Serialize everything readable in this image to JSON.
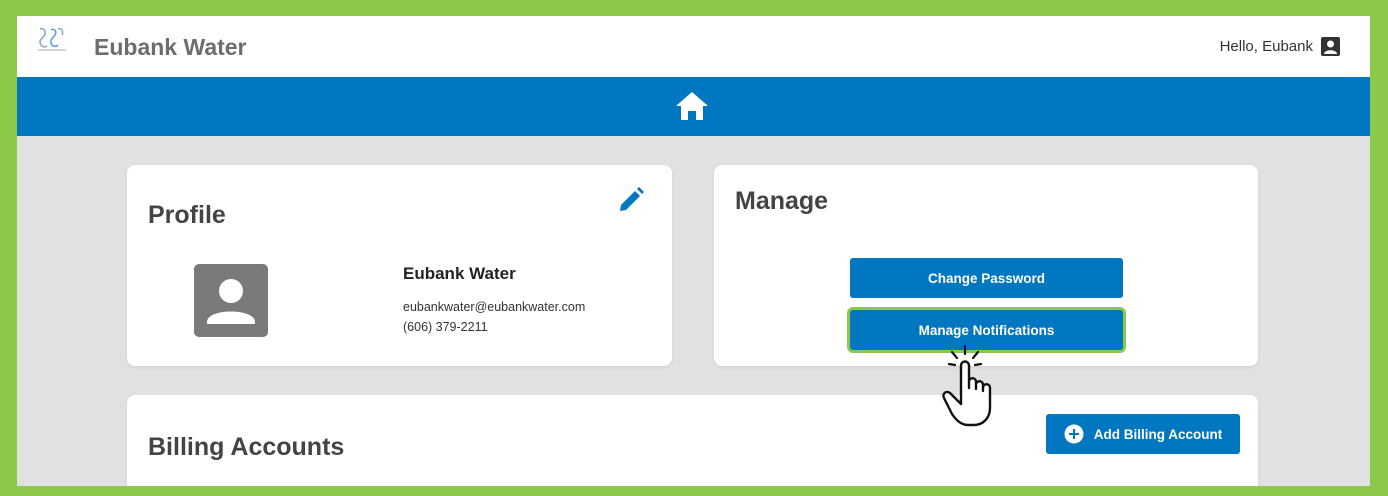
{
  "header": {
    "app_title": "Eubank Water",
    "greeting": "Hello, Eubank",
    "logo_icon": "water-drops-logo-icon",
    "user_icon": "user-icon"
  },
  "navbar": {
    "home_icon": "home-icon",
    "color": "#0077c0"
  },
  "profile": {
    "title": "Profile",
    "name": "Eubank Water",
    "email": "eubankwater@eubankwater.com",
    "phone": "(606) 379-2211",
    "edit_icon": "pencil-icon",
    "avatar_icon": "avatar-icon"
  },
  "manage": {
    "title": "Manage",
    "change_password_label": "Change Password",
    "manage_notifications_label": "Manage Notifications"
  },
  "billing": {
    "title": "Billing Accounts",
    "add_label": "Add Billing Account",
    "add_icon": "plus-circle-icon"
  },
  "colors": {
    "accent": "#0077c0",
    "highlight": "#8cc94b",
    "background": "#e1e1e1"
  },
  "annotation": {
    "pointer_icon": "hand-pointer-icon"
  }
}
